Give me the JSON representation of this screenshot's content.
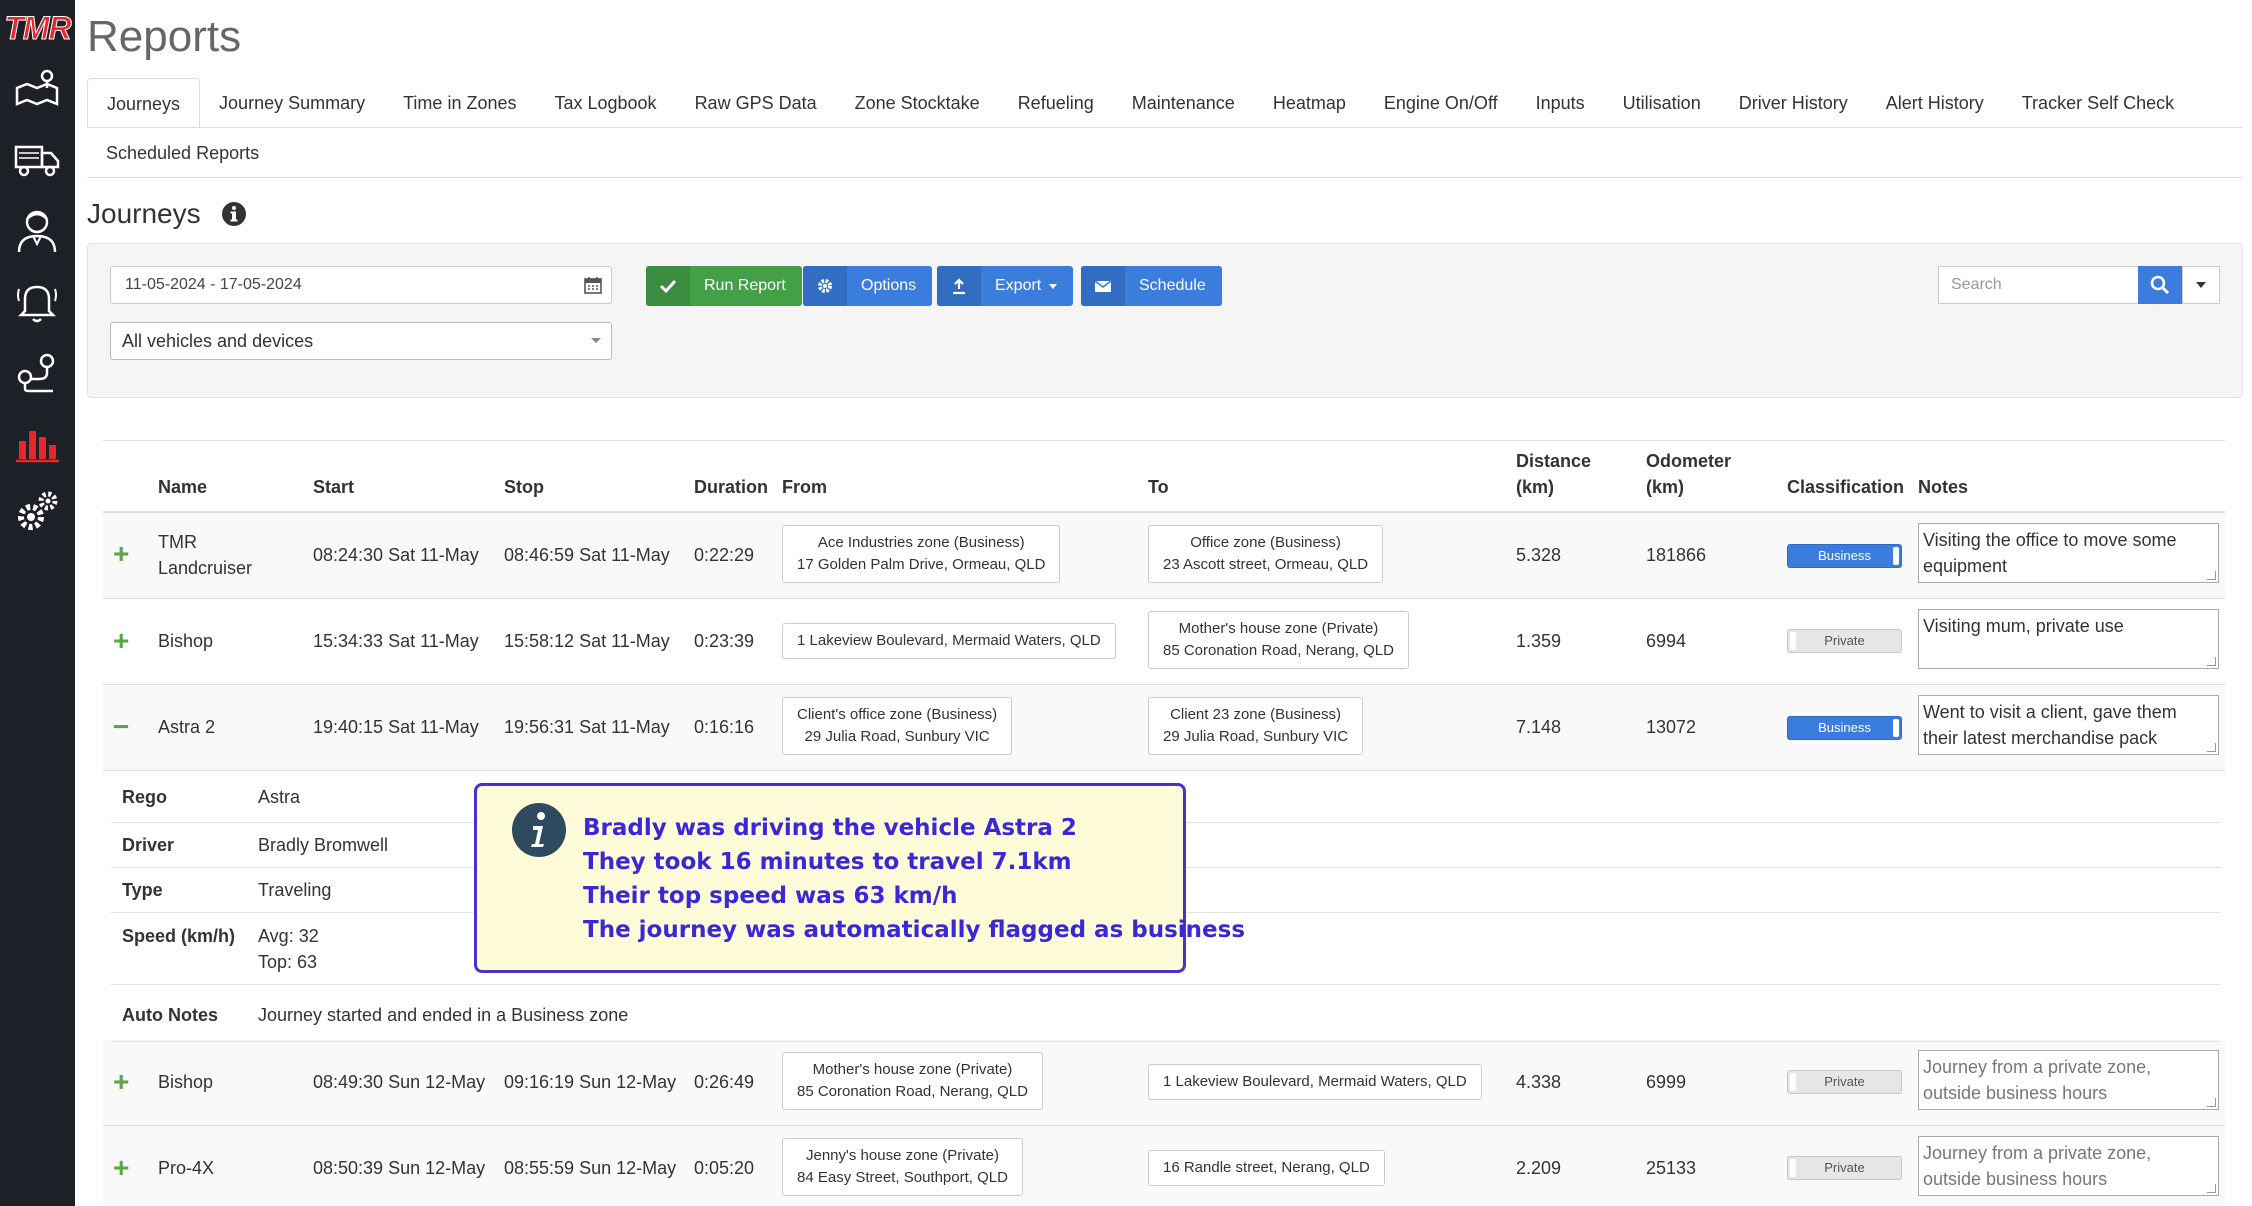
{
  "app": {
    "logo": "TMR"
  },
  "sidebar": {
    "items": [
      {
        "icon": "map-route-icon"
      },
      {
        "icon": "truck-icon"
      },
      {
        "icon": "driver-icon"
      },
      {
        "icon": "bell-icon"
      },
      {
        "icon": "location-pin-icon"
      },
      {
        "icon": "bar-chart-icon"
      },
      {
        "icon": "gears-icon"
      }
    ],
    "active_color": "#e8272a"
  },
  "page": {
    "title": "Reports"
  },
  "tabs": {
    "row1": [
      "Journeys",
      "Journey Summary",
      "Time in Zones",
      "Tax Logbook",
      "Raw GPS Data",
      "Zone Stocktake",
      "Refueling",
      "Maintenance",
      "Heatmap",
      "Engine On/Off",
      "Inputs",
      "Utilisation",
      "Driver History",
      "Alert History",
      "Tracker Self Check"
    ],
    "row2": [
      "Scheduled Reports"
    ],
    "active": "Journeys"
  },
  "section": {
    "title": "Journeys"
  },
  "filters": {
    "date_range": "11-05-2024 - 17-05-2024",
    "vehicle_select": "All vehicles and devices",
    "run_report": "Run Report",
    "options": "Options",
    "export": "Export",
    "schedule": "Schedule",
    "search_placeholder": "Search"
  },
  "table": {
    "headers": {
      "name": "Name",
      "start": "Start",
      "stop": "Stop",
      "duration": "Duration",
      "from": "From",
      "to": "To",
      "distance_1": "Distance",
      "distance_2": "(km)",
      "odometer_1": "Odometer",
      "odometer_2": "(km)",
      "classification": "Classification",
      "notes": "Notes"
    },
    "rows": [
      {
        "expand": "+",
        "name1": "TMR",
        "name2": "Landcruiser",
        "start": "08:24:30 Sat 11-May",
        "stop": "08:46:59 Sat 11-May",
        "duration": "0:22:29",
        "from1": "Ace Industries zone (Business)",
        "from2": "17 Golden Palm Drive, Ormeau, QLD",
        "to1": "Office zone (Business)",
        "to2": "23 Ascott street, Ormeau, QLD",
        "distance": "5.328",
        "odometer": "181866",
        "classification": "Business",
        "notes": "Visiting the office to move some equipment"
      },
      {
        "expand": "+",
        "name1": "Bishop",
        "start": "15:34:33 Sat 11-May",
        "stop": "15:58:12 Sat 11-May",
        "duration": "0:23:39",
        "from1": "1 Lakeview Boulevard, Mermaid Waters, QLD",
        "to1": "Mother's house zone (Private)",
        "to2": "85 Coronation Road, Nerang, QLD",
        "distance": "1.359",
        "odometer": "6994",
        "classification": "Private",
        "notes": "Visiting mum, private use"
      },
      {
        "expand": "−",
        "name1": "Astra 2",
        "start": "19:40:15 Sat 11-May",
        "stop": "19:56:31 Sat 11-May",
        "duration": "0:16:16",
        "from1": "Client's office zone (Business)",
        "from2": "29 Julia Road, Sunbury VIC",
        "to1": "Client 23 zone (Business)",
        "to2": "29 Julia Road, Sunbury VIC",
        "distance": "7.148",
        "odometer": "13072",
        "classification": "Business",
        "notes": "Went to visit a client, gave them their latest merchandise pack"
      },
      {
        "expand": "+",
        "name1": "Bishop",
        "start": "08:49:30 Sun 12-May",
        "stop": "09:16:19 Sun 12-May",
        "duration": "0:26:49",
        "from1": "Mother's house zone (Private)",
        "from2": "85 Coronation Road, Nerang, QLD",
        "to1": "1 Lakeview Boulevard, Mermaid Waters, QLD",
        "distance": "4.338",
        "odometer": "6999",
        "classification": "Private",
        "notes": "Journey from a private zone, outside business hours"
      },
      {
        "expand": "+",
        "name1": "Pro-4X",
        "start": "08:50:39 Sun 12-May",
        "stop": "08:55:59 Sun 12-May",
        "duration": "0:05:20",
        "from1": "Jenny's house zone (Private)",
        "from2": "84 Easy Street, Southport, QLD",
        "to1": "16 Randle street, Nerang, QLD",
        "distance": "2.209",
        "odometer": "25133",
        "classification": "Private",
        "notes": "Journey from a private zone, outside business hours"
      }
    ]
  },
  "detail": {
    "rego_label": "Rego",
    "rego": "Astra",
    "driver_label": "Driver",
    "driver": "Bradly Bromwell",
    "type_label": "Type",
    "type": "Traveling",
    "speed_label": "Speed (km/h)",
    "speed_avg": "Avg: 32",
    "speed_top": "Top: 63",
    "auto_notes_label": "Auto Notes",
    "auto_notes": "Journey started and ended in a Business zone"
  },
  "callout": {
    "line1": "Bradly was driving the vehicle Astra 2",
    "line2": "They took 16 minutes to travel 7.1km",
    "line3": "Their top speed was 63 km/h",
    "line4": "The journey was automatically flagged as business"
  }
}
